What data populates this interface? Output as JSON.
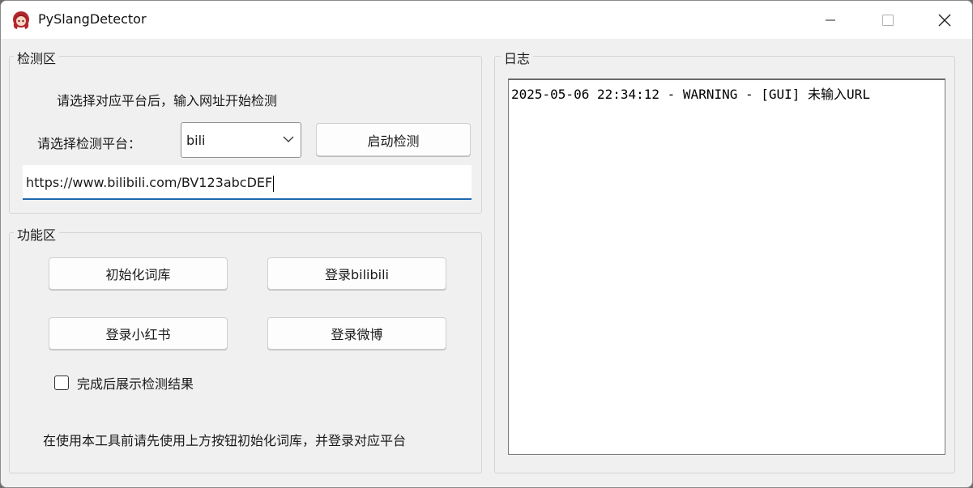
{
  "window": {
    "title": "PySlangDetector",
    "icon": "app-avatar-icon"
  },
  "detect_area": {
    "title": "检测区",
    "instruction": "请选择对应平台后，输入网址开始检测",
    "platform_label": "请选择检测平台：",
    "platform_selected": "bili",
    "start_button": "启动检测",
    "url_value": "https://www.bilibili.com/BV123abcDEF"
  },
  "function_area": {
    "title": "功能区",
    "init_button": "初始化词库",
    "login_bilibili_button": "登录bilibili",
    "login_xhs_button": "登录小红书",
    "login_weibo_button": "登录微博",
    "show_results_label": "完成后展示检测结果",
    "show_results_checked": false,
    "hint": "在使用本工具前请先使用上方按钮初始化词库，并登录对应平台"
  },
  "log_area": {
    "title": "日志",
    "lines": [
      "2025-05-06 22:34:12 - WARNING - [GUI] 未输入URL"
    ]
  },
  "colors": {
    "accent": "#1e68b0",
    "window_bg": "#f0f0f0"
  }
}
